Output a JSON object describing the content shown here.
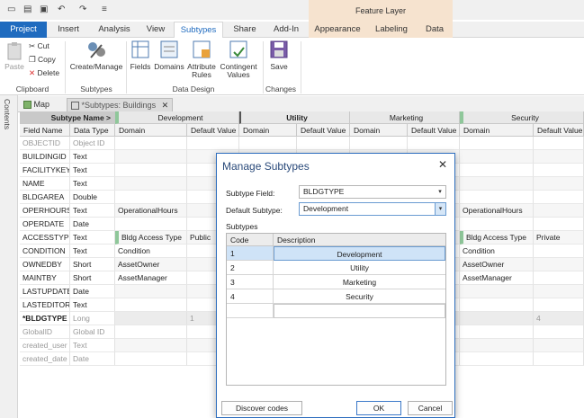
{
  "qat": {
    "icons": [
      "new-project-icon",
      "open-icon",
      "save-icon",
      "undo-icon",
      "redo-icon",
      "customize-icon"
    ]
  },
  "context": {
    "label": "Feature Layer"
  },
  "tabs": [
    {
      "label": "Project"
    },
    {
      "label": "Insert"
    },
    {
      "label": "Analysis"
    },
    {
      "label": "View"
    },
    {
      "label": "Subtypes"
    },
    {
      "label": "Share"
    },
    {
      "label": "Add-In"
    },
    {
      "label": "Appearance"
    },
    {
      "label": "Labeling"
    },
    {
      "label": "Data"
    }
  ],
  "ribbon": {
    "paste": "Paste",
    "cut": "Cut",
    "copy": "Copy",
    "delete": "Delete",
    "clipboard_group": "Clipboard",
    "create_manage": "Create/Manage",
    "subtypes_group": "Subtypes",
    "fields": "Fields",
    "domains": "Domains",
    "attribute_rules_1": "Attribute",
    "attribute_rules_2": "Rules",
    "contingent_1": "Contingent",
    "contingent_2": "Values",
    "data_design_group": "Data Design",
    "save": "Save",
    "changes_group": "Changes"
  },
  "side": {
    "contents": "Contents"
  },
  "viewtabs": {
    "map": "Map",
    "subtypes": "*Subtypes: Buildings"
  },
  "grid": {
    "subtype_name_header": "Subtype Name >",
    "groups": [
      "Development",
      "Utility",
      "Marketing",
      "Security"
    ],
    "field_name_header": "Field Name",
    "data_type_header": "Data Type",
    "domain_header": "Domain",
    "default_header": "Default Value",
    "rows": [
      {
        "name": "OBJECTID",
        "type": "Object ID",
        "dev_dom": "",
        "dev_def": "",
        "sec_dom": "",
        "sec_def": ""
      },
      {
        "name": "BUILDINGID",
        "type": "Text",
        "dev_dom": "",
        "dev_def": "",
        "sec_dom": "",
        "sec_def": ""
      },
      {
        "name": "FACILITYKEY",
        "type": "Text",
        "dev_dom": "",
        "dev_def": "",
        "sec_dom": "",
        "sec_def": ""
      },
      {
        "name": "NAME",
        "type": "Text",
        "dev_dom": "",
        "dev_def": "",
        "sec_dom": "",
        "sec_def": ""
      },
      {
        "name": "BLDGAREA",
        "type": "Double",
        "dev_dom": "",
        "dev_def": "",
        "sec_dom": "",
        "sec_def": ""
      },
      {
        "name": "OPERHOURS",
        "type": "Text",
        "dev_dom": "OperationalHours",
        "dev_def": "",
        "sec_dom": "OperationalHours",
        "sec_def": ""
      },
      {
        "name": "OPERDATE",
        "type": "Date",
        "dev_dom": "",
        "dev_def": "",
        "sec_dom": "",
        "sec_def": ""
      },
      {
        "name": "ACCESSTYPE",
        "type": "Text",
        "dev_dom": "Bldg Access Type",
        "dev_def": "Public",
        "sec_dom": "Bldg Access Type",
        "sec_def": "Private"
      },
      {
        "name": "CONDITION",
        "type": "Text",
        "dev_dom": "Condition",
        "dev_def": "",
        "sec_dom": "Condition",
        "sec_def": ""
      },
      {
        "name": "OWNEDBY",
        "type": "Short",
        "dev_dom": "AssetOwner",
        "dev_def": "",
        "sec_dom": "AssetOwner",
        "sec_def": ""
      },
      {
        "name": "MAINTBY",
        "type": "Short",
        "dev_dom": "AssetManager",
        "dev_def": "",
        "sec_dom": "AssetManager",
        "sec_def": ""
      },
      {
        "name": "LASTUPDATE",
        "type": "Date",
        "dev_dom": "",
        "dev_def": "",
        "sec_dom": "",
        "sec_def": ""
      },
      {
        "name": "LASTEDITOR",
        "type": "Text",
        "dev_dom": "",
        "dev_def": "",
        "sec_dom": "",
        "sec_def": ""
      },
      {
        "name": "*BLDGTYPE",
        "type": "Long",
        "dev_dom": "",
        "dev_def": "1",
        "sec_dom": "",
        "sec_def": "4"
      },
      {
        "name": "GlobalID",
        "type": "Global ID",
        "dev_dom": "",
        "dev_def": "",
        "sec_dom": "",
        "sec_def": ""
      },
      {
        "name": "created_user",
        "type": "Text",
        "dev_dom": "",
        "dev_def": "",
        "sec_dom": "",
        "sec_def": ""
      },
      {
        "name": "created_date",
        "type": "Date",
        "dev_dom": "",
        "dev_def": "",
        "sec_dom": "",
        "sec_def": ""
      }
    ]
  },
  "dialog": {
    "title": "Manage Subtypes",
    "subtype_field_label": "Subtype Field:",
    "subtype_field_value": "BLDGTYPE",
    "default_subtype_label": "Default Subtype:",
    "default_subtype_value": "Development",
    "subtypes_label": "Subtypes",
    "code_header": "Code",
    "desc_header": "Description",
    "rows": [
      {
        "code": "1",
        "desc": "Development"
      },
      {
        "code": "2",
        "desc": "Utility"
      },
      {
        "code": "3",
        "desc": "Marketing"
      },
      {
        "code": "4",
        "desc": "Security"
      }
    ],
    "discover": "Discover codes",
    "ok": "OK",
    "cancel": "Cancel"
  },
  "colors": {
    "accent": "#1f6bbf",
    "context": "#f6e3cf",
    "selected": "#cfe3f7",
    "green_marker": "#8fc79a"
  }
}
